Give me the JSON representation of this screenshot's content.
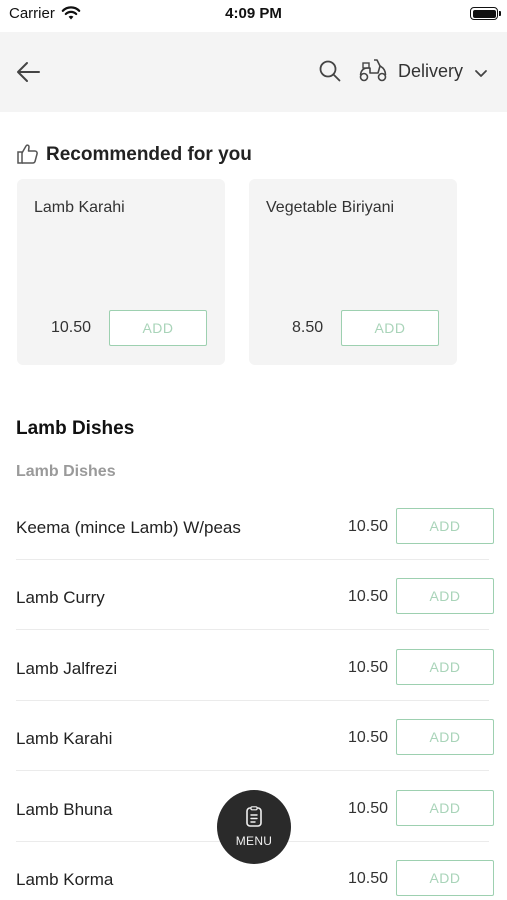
{
  "status_bar": {
    "carrier": "Carrier",
    "time": "4:09 PM"
  },
  "nav": {
    "back_icon": "arrow-left-icon",
    "search_icon": "search-icon",
    "mode_icon": "scooter-icon",
    "mode_label": "Delivery",
    "mode_chevron": "chevron-down-icon"
  },
  "recommended": {
    "icon": "thumbs-up-icon",
    "title": "Recommended for you",
    "items": [
      {
        "name": "Lamb Karahi",
        "price": "10.50",
        "add_label": "ADD"
      },
      {
        "name": "Vegetable Biriyani",
        "price": "8.50",
        "add_label": "ADD"
      }
    ]
  },
  "menu": {
    "section_title": "Lamb Dishes",
    "category_title": "Lamb Dishes",
    "items": [
      {
        "name": "Keema (mince Lamb) W/peas",
        "price": "10.50",
        "add_label": "ADD"
      },
      {
        "name": "Lamb Curry",
        "price": "10.50",
        "add_label": "ADD"
      },
      {
        "name": "Lamb Jalfrezi",
        "price": "10.50",
        "add_label": "ADD"
      },
      {
        "name": "Lamb Karahi",
        "price": "10.50",
        "add_label": "ADD"
      },
      {
        "name": "Lamb Bhuna",
        "price": "10.50",
        "add_label": "ADD"
      },
      {
        "name": "Lamb Korma",
        "price": "10.50",
        "add_label": "ADD"
      }
    ]
  },
  "fab": {
    "icon": "menu-card-icon",
    "label": "MENU"
  },
  "colors": {
    "accent_green": "#9dd0b0",
    "nav_background": "#f4f4f4",
    "fab_background": "#2a2a2a"
  }
}
